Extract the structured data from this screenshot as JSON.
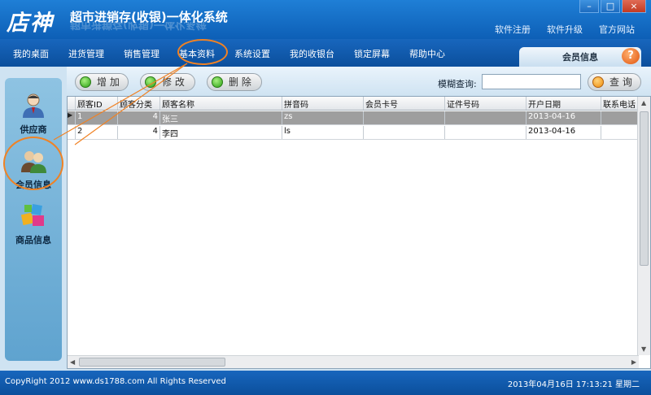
{
  "app": {
    "logo": "店神",
    "title": "超市进销存(收银)一体化系统",
    "top_links": [
      "软件注册",
      "软件升级",
      "官方网站"
    ],
    "window_controls": [
      "–",
      "□",
      "×"
    ]
  },
  "menu": {
    "items": [
      "我的桌面",
      "进货管理",
      "销售管理",
      "基本资料",
      "系统设置",
      "我的收银台",
      "锁定屏幕",
      "帮助中心"
    ],
    "active": "基本资料"
  },
  "panel": {
    "tab_title": "会员信息",
    "help_glyph": "?"
  },
  "sidebar": {
    "items": [
      {
        "label": "供应商",
        "icon": "supplier-person-icon"
      },
      {
        "label": "会员信息",
        "icon": "member-group-icon"
      },
      {
        "label": "商品信息",
        "icon": "product-boxes-icon"
      }
    ],
    "active": "会员信息"
  },
  "toolbar": {
    "add_label": "增 加",
    "edit_label": "修 改",
    "delete_label": "删 除",
    "search_label": "模糊查询:",
    "search_value": "",
    "query_label": "查 询"
  },
  "grid": {
    "columns": [
      "顾客ID",
      "顾客分类",
      "顾客名称",
      "拼音码",
      "会员卡号",
      "证件号码",
      "开户日期",
      "联系电话"
    ],
    "rows": [
      [
        "1",
        "4",
        "张三",
        "zs",
        "",
        "",
        "2013-04-16",
        ""
      ],
      [
        "2",
        "4",
        "李四",
        "ls",
        "",
        "",
        "2013-04-16",
        ""
      ]
    ],
    "selected_row": 0
  },
  "status": {
    "copyright": "CopyRight  2012   www.ds1788.com   All Rights Reserved",
    "datetime": "2013年04月16日  17:13:21  星期二"
  },
  "colors": {
    "accent": "#0f5aa6",
    "highlight_ring": "#f08224",
    "selected_row": "#9e9e9e"
  }
}
